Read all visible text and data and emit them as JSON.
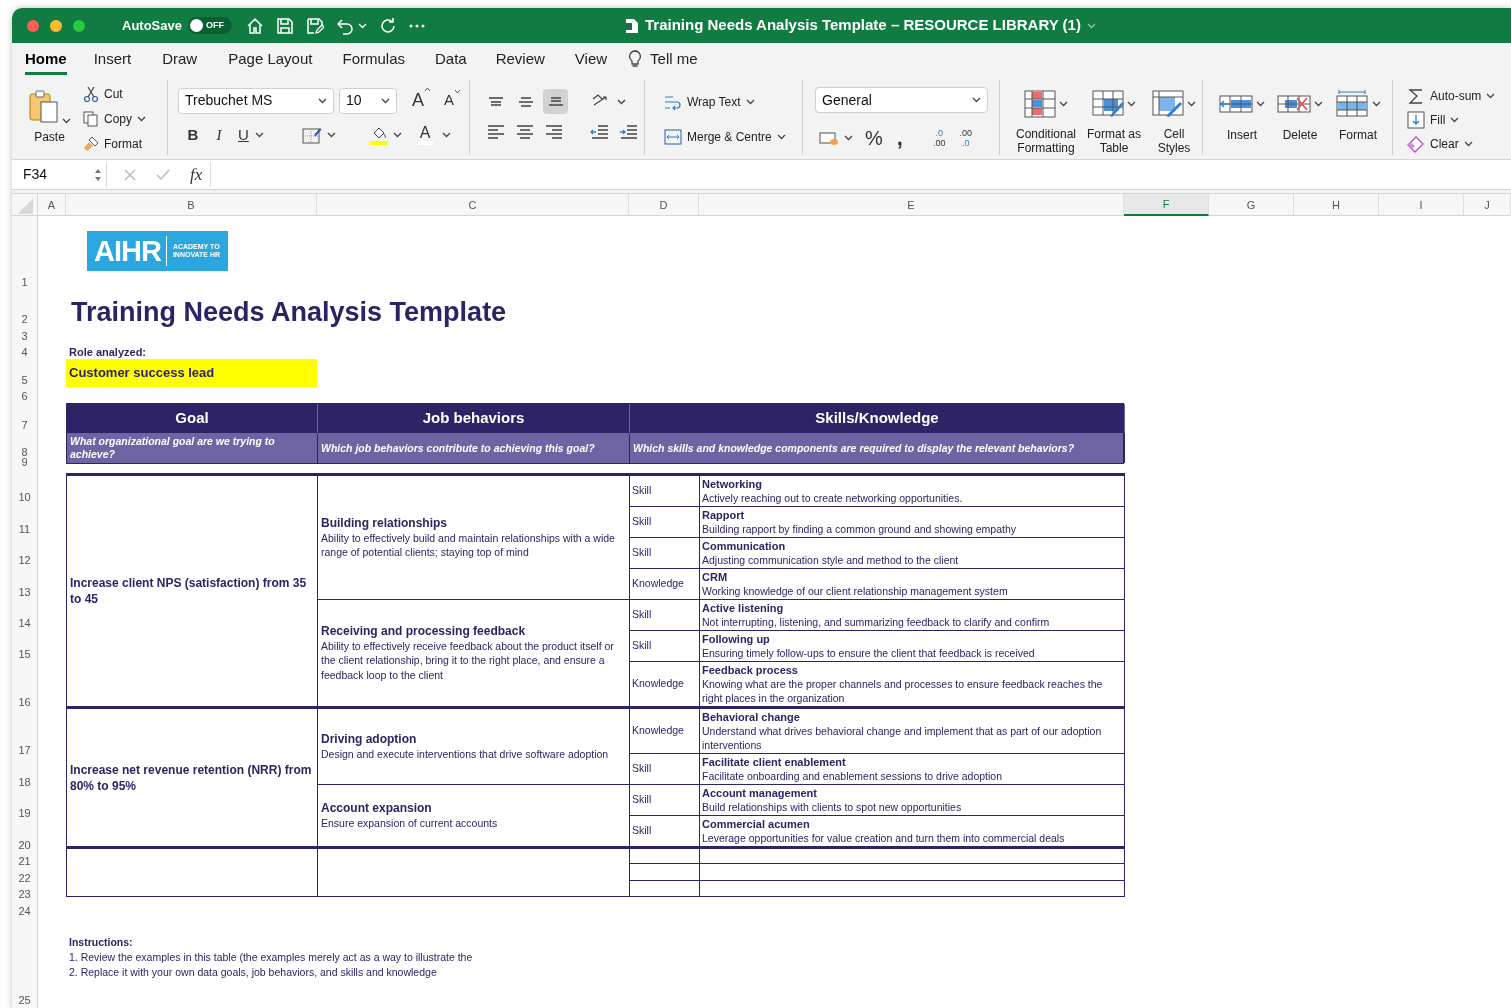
{
  "window": {
    "title": "Training Needs Analysis Template – RESOURCE LIBRARY (1)",
    "autosave_label": "AutoSave",
    "autosave_on": false,
    "autosave_state": "OFF"
  },
  "ribbon_tabs": [
    {
      "label": "Home",
      "selected": true
    },
    {
      "label": "Insert",
      "selected": false
    },
    {
      "label": "Draw",
      "selected": false
    },
    {
      "label": "Page Layout",
      "selected": false
    },
    {
      "label": "Formulas",
      "selected": false
    },
    {
      "label": "Data",
      "selected": false
    },
    {
      "label": "Review",
      "selected": false
    },
    {
      "label": "View",
      "selected": false
    }
  ],
  "tell_me": "Tell me",
  "ribbon": {
    "clipboard": {
      "paste": "Paste",
      "cut": "Cut",
      "copy": "Copy",
      "format": "Format"
    },
    "font": {
      "name": "Trebuchet MS",
      "size": "10",
      "grow": "A",
      "shrink": "A",
      "bold": "B",
      "italic": "I",
      "underline": "U",
      "font_color_label": "A"
    },
    "vertical_align": [
      {
        "selected": false
      },
      {
        "selected": false
      },
      {
        "selected": true
      }
    ],
    "wrap_text": "Wrap Text",
    "merge": "Merge & Centre",
    "number": {
      "format": "General",
      "percent": "%",
      "comma": ",",
      "increase_decimal": [
        ".0",
        ".00"
      ],
      "decrease_decimal": [
        ".00",
        ".0"
      ]
    },
    "styles": {
      "conditional": "Conditional Formatting",
      "format_table": "Format as Table",
      "cell_styles": "Cell Styles"
    },
    "cells": {
      "insert": "Insert",
      "delete": "Delete",
      "format": "Format"
    },
    "editing": {
      "autosum": "Auto-sum",
      "fill": "Fill",
      "clear": "Clear"
    }
  },
  "formula_bar": {
    "name_box": "F34",
    "fx": "fx"
  },
  "columns": [
    {
      "label": "A",
      "selected": false
    },
    {
      "label": "B",
      "selected": false
    },
    {
      "label": "C",
      "selected": false
    },
    {
      "label": "D",
      "selected": false
    },
    {
      "label": "E",
      "selected": false
    },
    {
      "label": "F",
      "selected": true
    },
    {
      "label": "G",
      "selected": false
    },
    {
      "label": "H",
      "selected": false
    },
    {
      "label": "I",
      "selected": false
    },
    {
      "label": "J",
      "selected": false
    }
  ],
  "row_numbers": [
    "1",
    "2",
    "3",
    "4",
    "5",
    "6",
    "7",
    "8",
    "9",
    "10",
    "11",
    "12",
    "13",
    "14",
    "15",
    "16",
    "17",
    "18",
    "19",
    "20",
    "21",
    "22",
    "23",
    "24",
    "25"
  ],
  "sheet": {
    "logo": {
      "wordmark": "AIHR",
      "tagline": "ACADEMY TO INNOVATE HR"
    },
    "title": "Training Needs Analysis Template",
    "role_label": "Role analyzed:",
    "role_value": "Customer success lead",
    "headers": [
      {
        "title": "Goal",
        "subtitle": "What organizational goal are we trying to achieve?"
      },
      {
        "title": "Job behaviors",
        "subtitle": "Which job behaviors contribute to achieving this goal?"
      },
      {
        "title": "Skills/Knowledge",
        "subtitle": "Which skills and knowledge components are required to display the relevant behaviors?"
      }
    ],
    "goals": [
      {
        "text": "Increase client NPS (satisfaction) from 35 to 45",
        "behaviors": [
          {
            "title": "Building relationships",
            "description": "Ability to effectively build and maintain relationships with a wide range of potential clients; staying top of mind",
            "skills": [
              {
                "type": "Skill",
                "name": "Networking",
                "description": "Actively reaching out to create networking opportunities."
              },
              {
                "type": "Skill",
                "name": "Rapport",
                "description": "Building rapport by finding a common ground and showing empathy"
              },
              {
                "type": "Skill",
                "name": "Communication",
                "description": "Adjusting communication style and method to the client"
              },
              {
                "type": "Knowledge",
                "name": "CRM",
                "description": "Working knowledge of our client relationship management system"
              }
            ]
          },
          {
            "title": "Receiving and processing feedback",
            "description": "Ability to effectively receive feedback about the product itself or the client relationship, bring it to the right place, and ensure a feedback loop to the client",
            "skills": [
              {
                "type": "Skill",
                "name": "Active listening",
                "description": "Not interrupting, listening, and summarizing feedback to clarify and confirm"
              },
              {
                "type": "Skill",
                "name": "Following up",
                "description": "Ensuring timely follow-ups to ensure the client that feedback is received"
              },
              {
                "type": "Knowledge",
                "name": "Feedback process",
                "description": "Knowing what are the proper channels and processes to ensure feedback reaches the right places in the organization"
              }
            ]
          }
        ]
      },
      {
        "text": "Increase net revenue retention (NRR) from 80% to 95%",
        "behaviors": [
          {
            "title": "Driving adoption",
            "description": "Design and execute interventions that drive software adoption",
            "skills": [
              {
                "type": "Knowledge",
                "name": "Behavioral change",
                "description": "Understand what drives behavioral change and implement that as part of our adoption interventions"
              },
              {
                "type": "Skill",
                "name": "Facilitate client enablement",
                "description": "Facilitate onboarding and enablement sessions to drive adoption"
              }
            ]
          },
          {
            "title": "Account expansion",
            "description": "Ensure expansion of current accounts",
            "skills": [
              {
                "type": "Skill",
                "name": "Account management",
                "description": "Build relationships with clients to spot new opportunities"
              },
              {
                "type": "Skill",
                "name": "Commercial acumen",
                "description": "Leverage opportunities for value creation and turn them into commercial deals"
              }
            ]
          }
        ]
      }
    ],
    "instructions": {
      "title": "Instructions:",
      "lines": [
        "1. Review the examples in this table (the examples merely act as a way to illustrate the",
        "2. Replace it with your own data goals, job behaviors, and skills and knowledge"
      ]
    }
  }
}
